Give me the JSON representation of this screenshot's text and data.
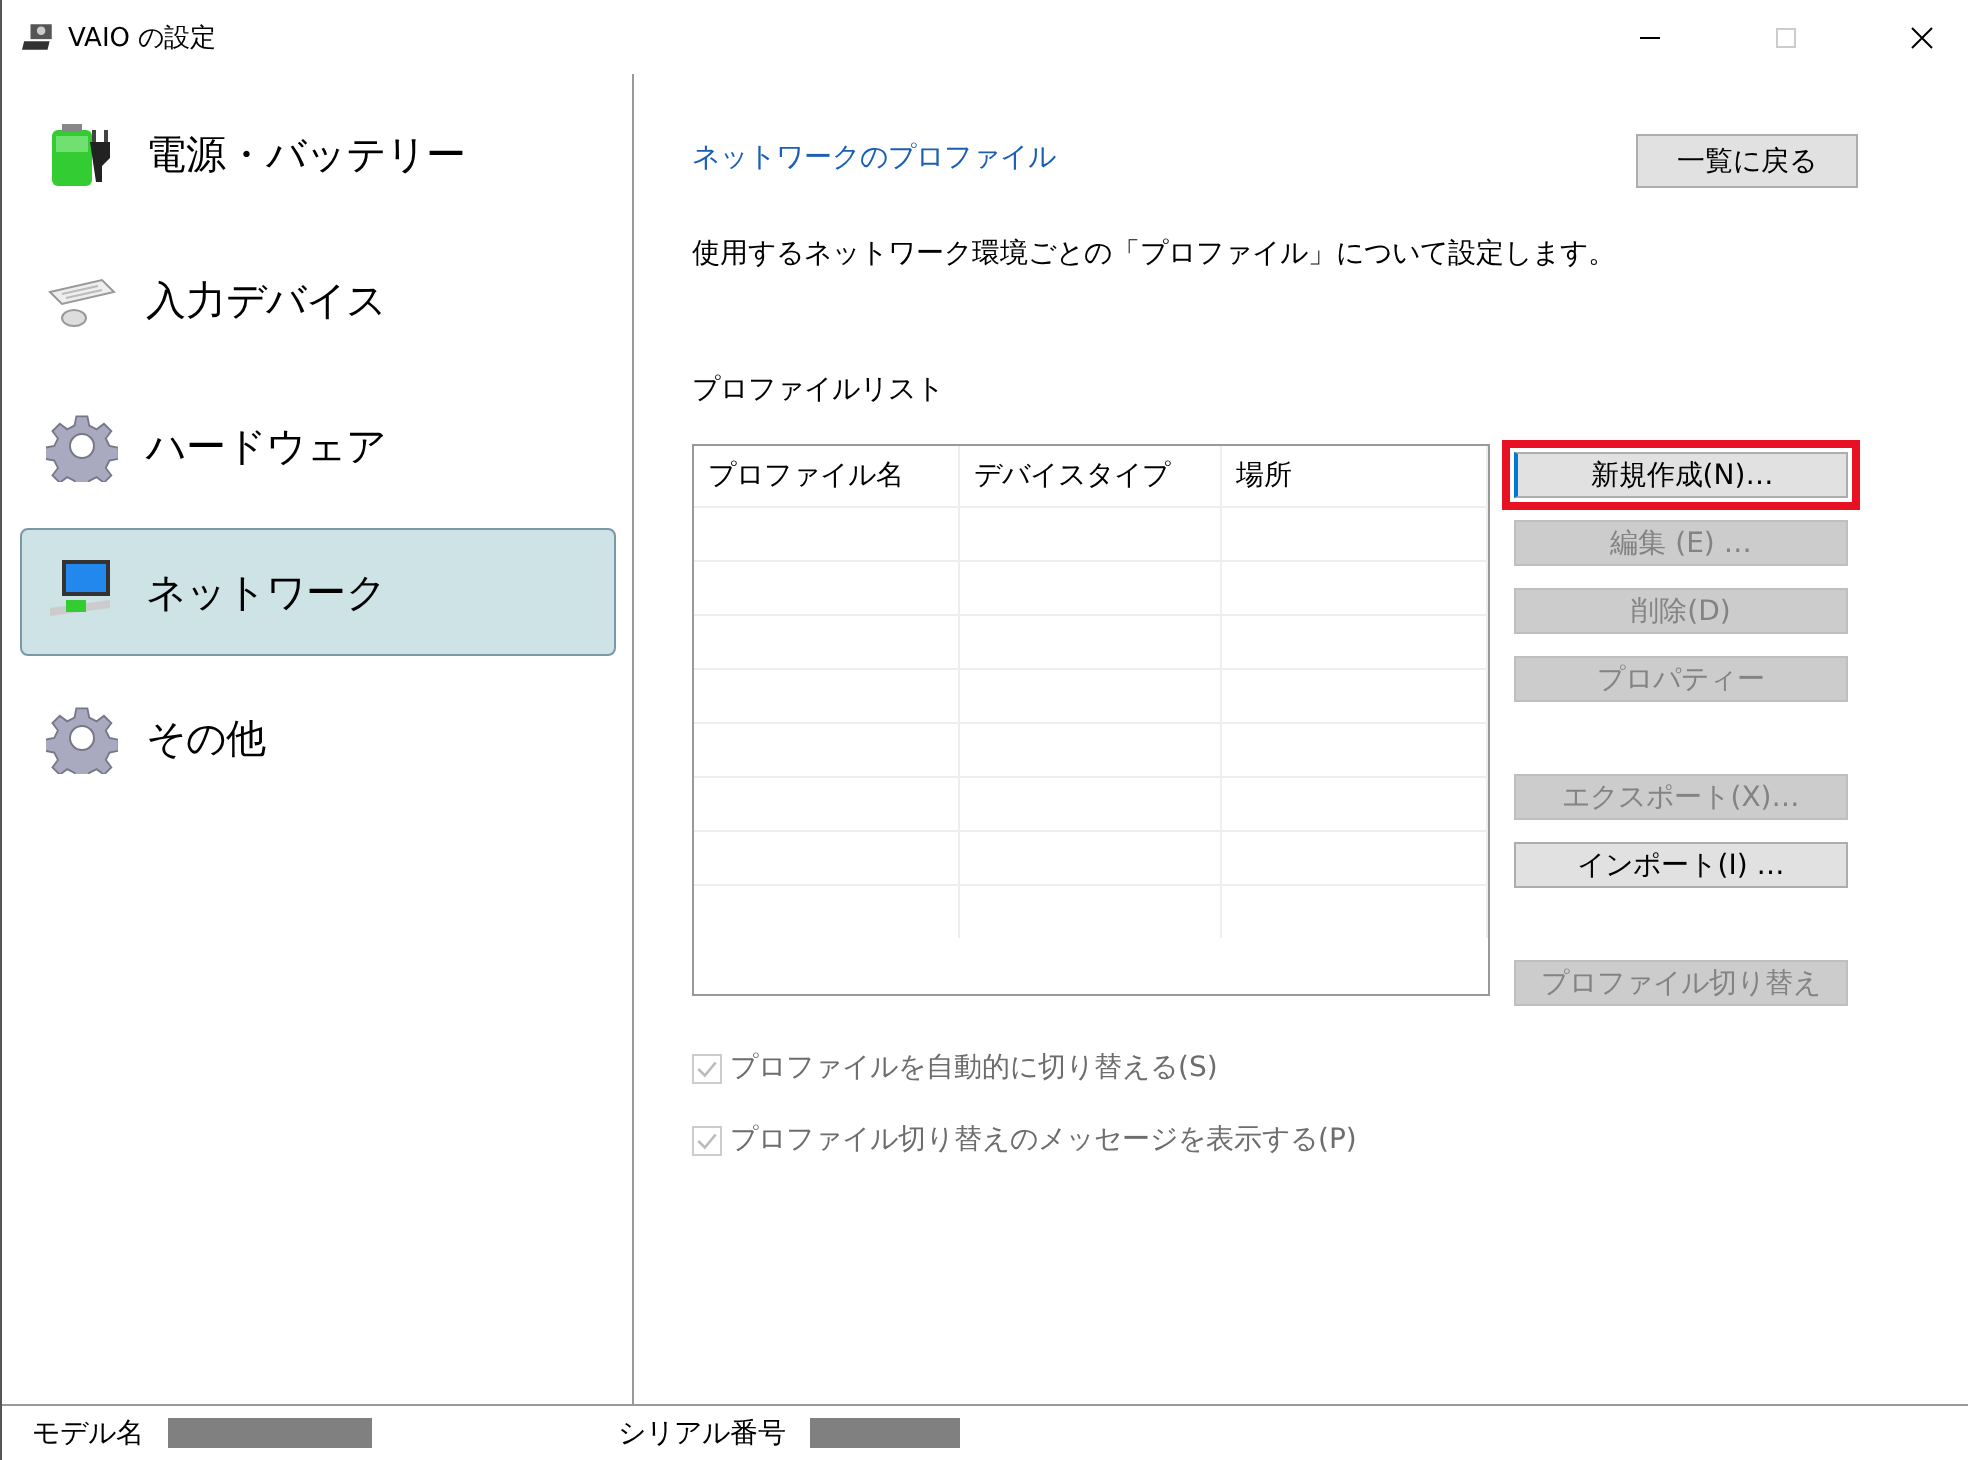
{
  "window": {
    "title": "VAIO の設定"
  },
  "sidebar": {
    "items": [
      {
        "label": "電源・バッテリー",
        "kind": "battery",
        "selected": false
      },
      {
        "label": "入力デバイス",
        "kind": "keyboard",
        "selected": false
      },
      {
        "label": "ハードウェア",
        "kind": "gear",
        "selected": false
      },
      {
        "label": "ネットワーク",
        "kind": "network",
        "selected": true
      },
      {
        "label": "その他",
        "kind": "gear",
        "selected": false
      }
    ]
  },
  "main": {
    "title": "ネットワークのプロファイル",
    "back_button": "一覧に戻る",
    "description": "使用するネットワーク環境ごとの「プロファイル」について設定します。",
    "list_label": "プロファイルリスト",
    "table": {
      "columns": [
        "プロファイル名",
        "デバイスタイプ",
        "場所"
      ]
    },
    "button_groups": [
      [
        {
          "label": "新規作成(N)…",
          "disabled": false,
          "highlighted": true
        },
        {
          "label": "編集 (E) …",
          "disabled": true,
          "highlighted": false
        },
        {
          "label": "削除(D)",
          "disabled": true,
          "highlighted": false
        },
        {
          "label": "プロパティー",
          "disabled": true,
          "highlighted": false
        }
      ],
      [
        {
          "label": "エクスポート(X)…",
          "disabled": true,
          "highlighted": false
        },
        {
          "label": "インポート(I) …",
          "disabled": false,
          "highlighted": false
        }
      ],
      [
        {
          "label": "プロファイル切り替え",
          "disabled": true,
          "highlighted": false
        }
      ]
    ],
    "checkboxes": [
      {
        "label": "プロファイルを自動的に切り替える(S)",
        "checked": true,
        "disabled": true
      },
      {
        "label": "プロファイル切り替えのメッセージを表示する(P)",
        "checked": true,
        "disabled": true
      }
    ]
  },
  "status_bar": {
    "model_label": "モデル名",
    "serial_label": "シリアル番号"
  }
}
